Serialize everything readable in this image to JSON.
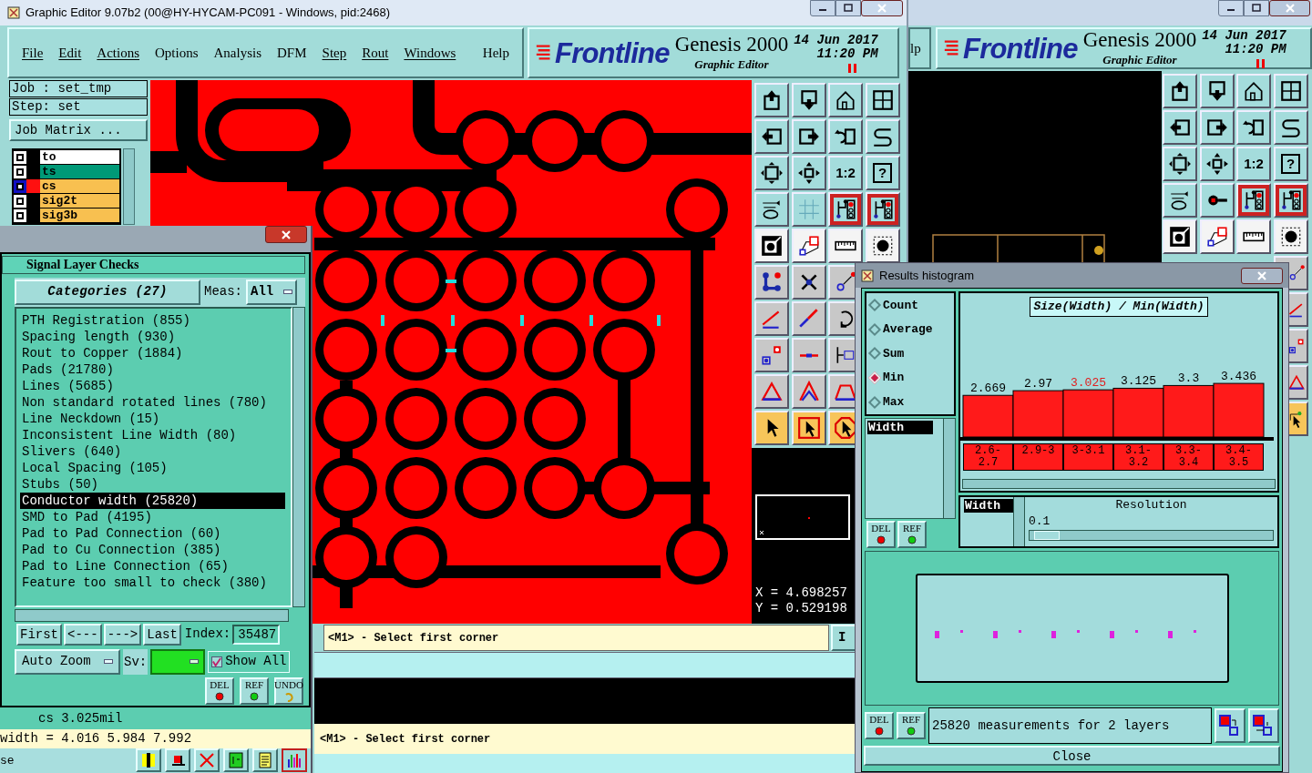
{
  "main_window": {
    "title": "Graphic Editor 9.07b2 (00@HY-HYCAM-PC091 - Windows, pid:2468)",
    "menu": [
      {
        "label": "File",
        "underlined": true
      },
      {
        "label": "Edit",
        "underlined": true
      },
      {
        "label": "Actions",
        "underlined": true
      },
      {
        "label": "Options",
        "underlined": false
      },
      {
        "label": "Analysis",
        "underlined": false
      },
      {
        "label": "DFM",
        "underlined": false
      },
      {
        "label": "Step",
        "underlined": true
      },
      {
        "label": "Rout",
        "underlined": true
      },
      {
        "label": "Windows",
        "underlined": true
      },
      {
        "label": "Help",
        "underlined": false
      }
    ],
    "brand": {
      "logo": "Frontline",
      "product": "Genesis 2000",
      "subtitle": "Graphic Editor",
      "date": "14 Jun 2017",
      "time": "11:20 PM"
    },
    "job": "Job : set_tmp",
    "step": "Step: set",
    "job_matrix_button": "Job Matrix ...",
    "layers": [
      {
        "name": "to",
        "color": "#ffffff",
        "active": false
      },
      {
        "name": "ts",
        "color": "#009977",
        "active": false
      },
      {
        "name": "cs",
        "color": "#f8c050",
        "active": true
      },
      {
        "name": "sig2t",
        "color": "#f8c050",
        "active": false
      },
      {
        "name": "sig3b",
        "color": "#f8c050",
        "active": false
      }
    ],
    "toolbar": {
      "scale_button": "1:2",
      "help_button": "?"
    },
    "coordinates": {
      "x": "X = 4.698257",
      "y": "Y = 0.529198"
    },
    "prompts": [
      "<M1> - Select first corner",
      "<M1> - Select first corner"
    ],
    "side_button": "I"
  },
  "second_window": {
    "menu_fragment": "lp",
    "brand": {
      "logo": "Frontline",
      "product": "Genesis 2000",
      "subtitle": "Graphic Editor",
      "date": "14 Jun 2017",
      "time": "11:20 PM"
    },
    "toolbar": {
      "scale_button": "1:2",
      "help_button": "?"
    }
  },
  "checks_dialog": {
    "heading": "Signal Layer Checks",
    "categories_button": "Categories (27)",
    "meas_label": "Meas:",
    "meas_value": "All",
    "items": [
      {
        "label": "PTH Registration (855)",
        "selected": false
      },
      {
        "label": "Spacing length (930)",
        "selected": false
      },
      {
        "label": "Rout to Copper (1884)",
        "selected": false
      },
      {
        "label": "Pads (21780)",
        "selected": false
      },
      {
        "label": "Lines (5685)",
        "selected": false
      },
      {
        "label": "Non standard rotated lines (780)",
        "selected": false
      },
      {
        "label": "Line Neckdown (15)",
        "selected": false
      },
      {
        "label": "Inconsistent Line Width (80)",
        "selected": false
      },
      {
        "label": "Slivers (640)",
        "selected": false
      },
      {
        "label": "Local Spacing (105)",
        "selected": false
      },
      {
        "label": "Stubs (50)",
        "selected": false
      },
      {
        "label": "Conductor width (25820)",
        "selected": true
      },
      {
        "label": "SMD to Pad (4195)",
        "selected": false
      },
      {
        "label": "Pad to Pad Connection (60)",
        "selected": false
      },
      {
        "label": "Pad to Cu Connection (385)",
        "selected": false
      },
      {
        "label": "Pad to Line Connection (65)",
        "selected": false
      },
      {
        "label": "Feature too small to check (380)",
        "selected": false
      }
    ],
    "nav_buttons": [
      "First",
      "<---",
      "--->",
      "Last"
    ],
    "index_label": "Index:",
    "index_value": "35487",
    "zoom_mode": "Auto Zoom",
    "sv_label": "Sv:",
    "show_all": {
      "label": "Show All",
      "checked": true
    },
    "action_buttons": [
      "DEL",
      "REF",
      "UNDO"
    ],
    "current": "cs 3.025mil",
    "width_line": "width = 4.016 5.984 7.992",
    "status_fragment": "se"
  },
  "histogram": {
    "title": "Results histogram",
    "modes": [
      {
        "label": "Count",
        "selected": false
      },
      {
        "label": "Average",
        "selected": false
      },
      {
        "label": "Sum",
        "selected": false
      },
      {
        "label": "Min",
        "selected": true
      },
      {
        "label": "Max",
        "selected": false
      }
    ],
    "attributes": [
      {
        "label": "Width",
        "selected": true
      }
    ],
    "side_buttons": [
      "DEL",
      "REF"
    ],
    "chart_title": "Size(Width) / Min(Width)",
    "chart_data": {
      "type": "bar",
      "categories": [
        "2.6-2.7",
        "2.9-3",
        "3-3.1",
        "3.1-3.2",
        "3.3-3.4",
        "3.4-3.5"
      ],
      "values": [
        2.669,
        2.97,
        3.025,
        3.125,
        3.3,
        3.436
      ],
      "value_labels": [
        "2.669",
        "2.97",
        "3.025",
        "3.125",
        "3.3",
        "3.436"
      ],
      "ylim": [
        0,
        3.5
      ]
    },
    "highlighted": [
      false,
      false,
      true,
      false,
      false,
      false
    ],
    "groups": [
      {
        "label": "Width",
        "selected": true
      }
    ],
    "resolution": {
      "label": "Resolution",
      "value": "0.1",
      "level": 0.02
    },
    "bottom_buttons": [
      "DEL",
      "REF"
    ],
    "summary": "25820 measurements for 2 layers",
    "close": "Close"
  }
}
